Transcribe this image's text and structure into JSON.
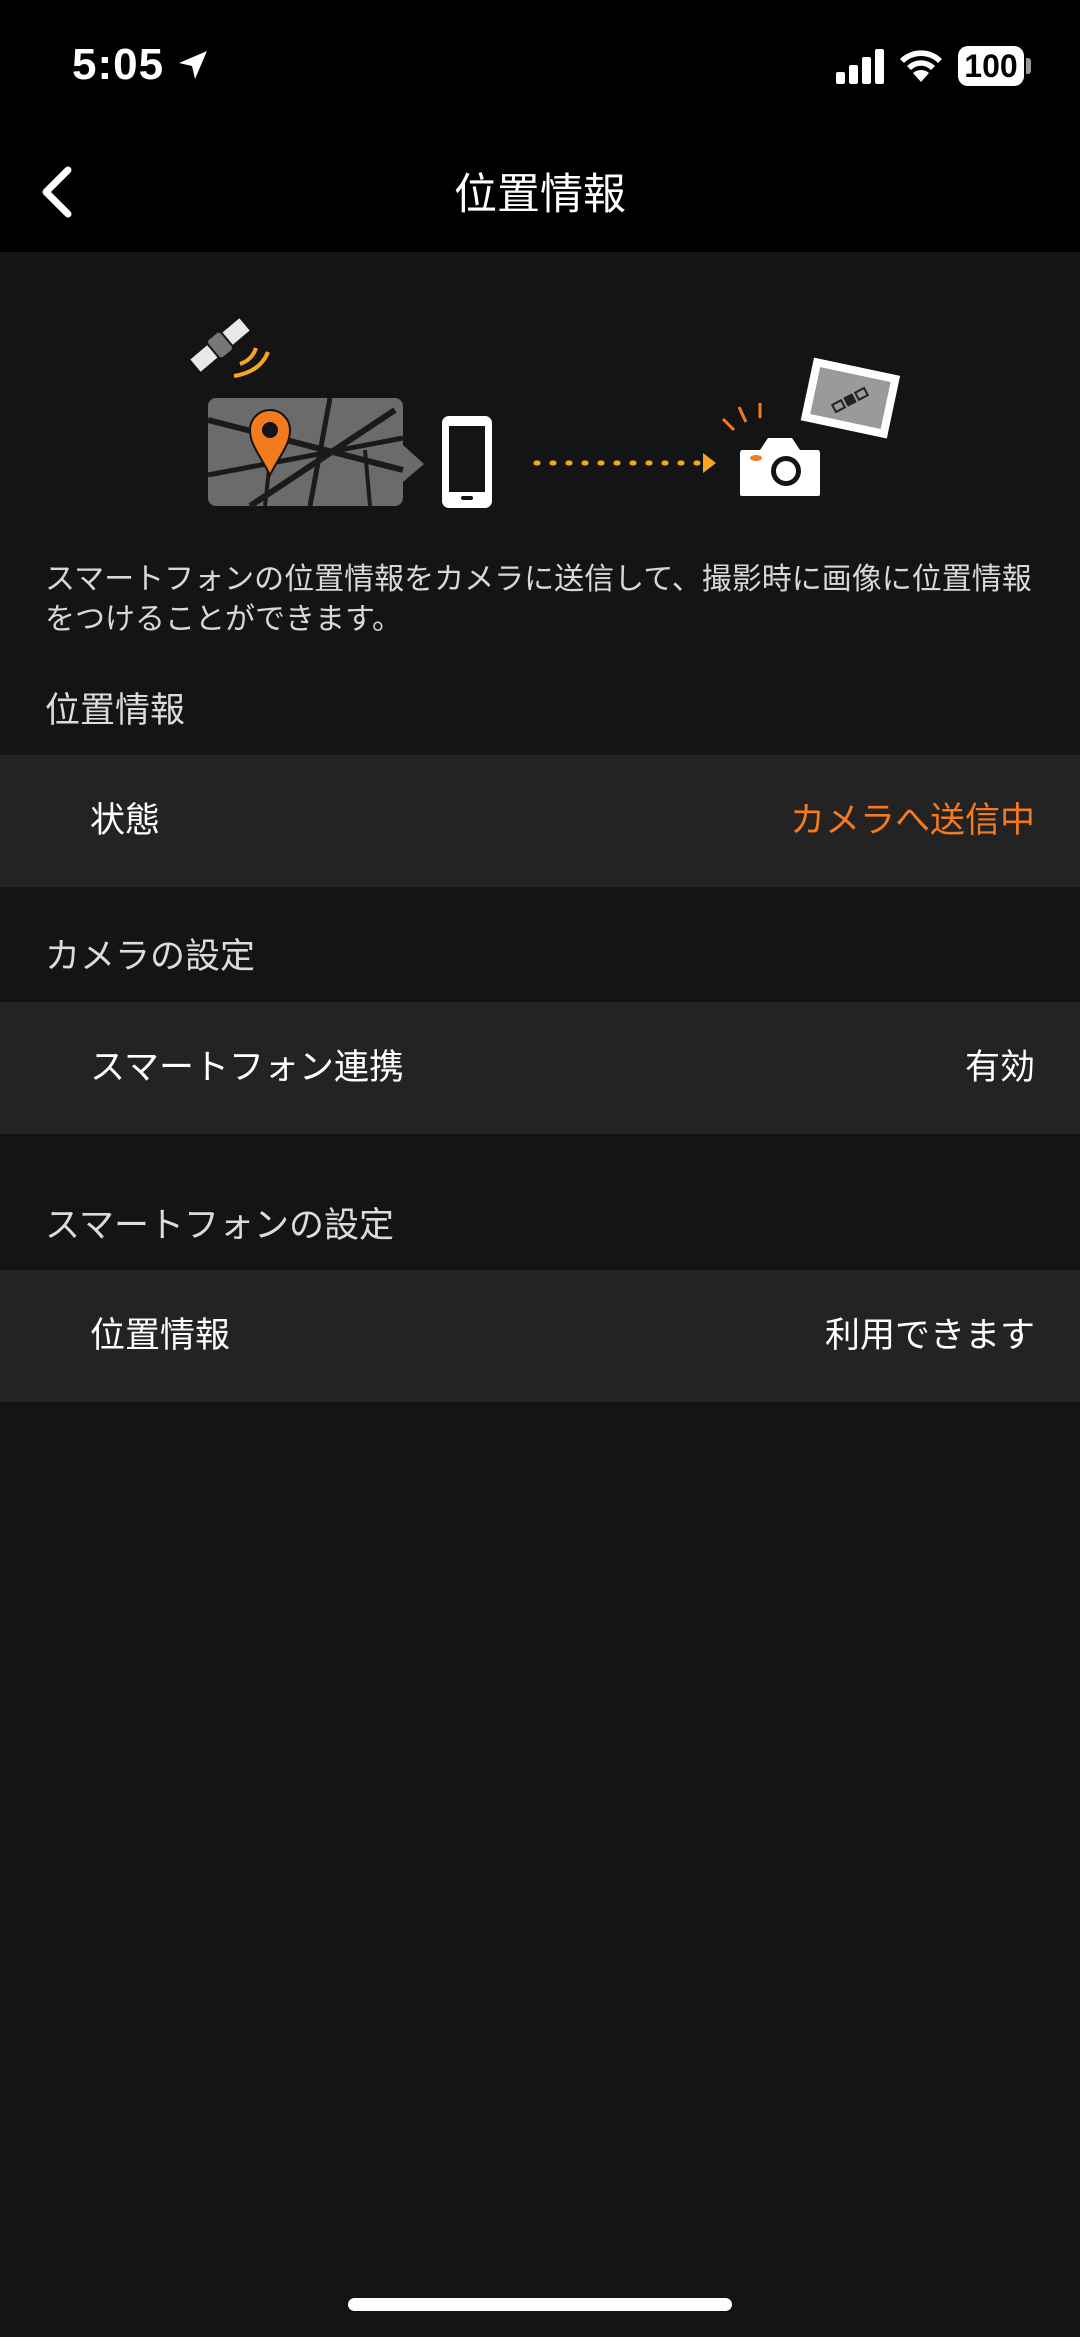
{
  "status_bar": {
    "time": "5:05",
    "battery": "100",
    "icons": [
      "location-arrow-icon",
      "signal-bars-icon",
      "wifi-icon",
      "battery-icon"
    ]
  },
  "nav": {
    "back_icon": "chevron-left-icon",
    "title": "位置情報"
  },
  "description": "スマートフォンの位置情報をカメラに送信して、撮影時に画像に位置情報をつけることができます。",
  "sections": {
    "location": {
      "header": "位置情報",
      "rows": [
        {
          "label": "状態",
          "value": "カメラへ送信中"
        }
      ]
    },
    "camera": {
      "header": "カメラの設定",
      "rows": [
        {
          "label": "スマートフォン連携",
          "value": "有効"
        }
      ]
    },
    "smartphone": {
      "header": "スマートフォンの設定",
      "rows": [
        {
          "label": "位置情報",
          "value": "利用できます"
        }
      ]
    }
  },
  "colors": {
    "accent": "#f47a1f",
    "background": "#141414",
    "row_background": "#232323",
    "bar_background": "#000000"
  }
}
